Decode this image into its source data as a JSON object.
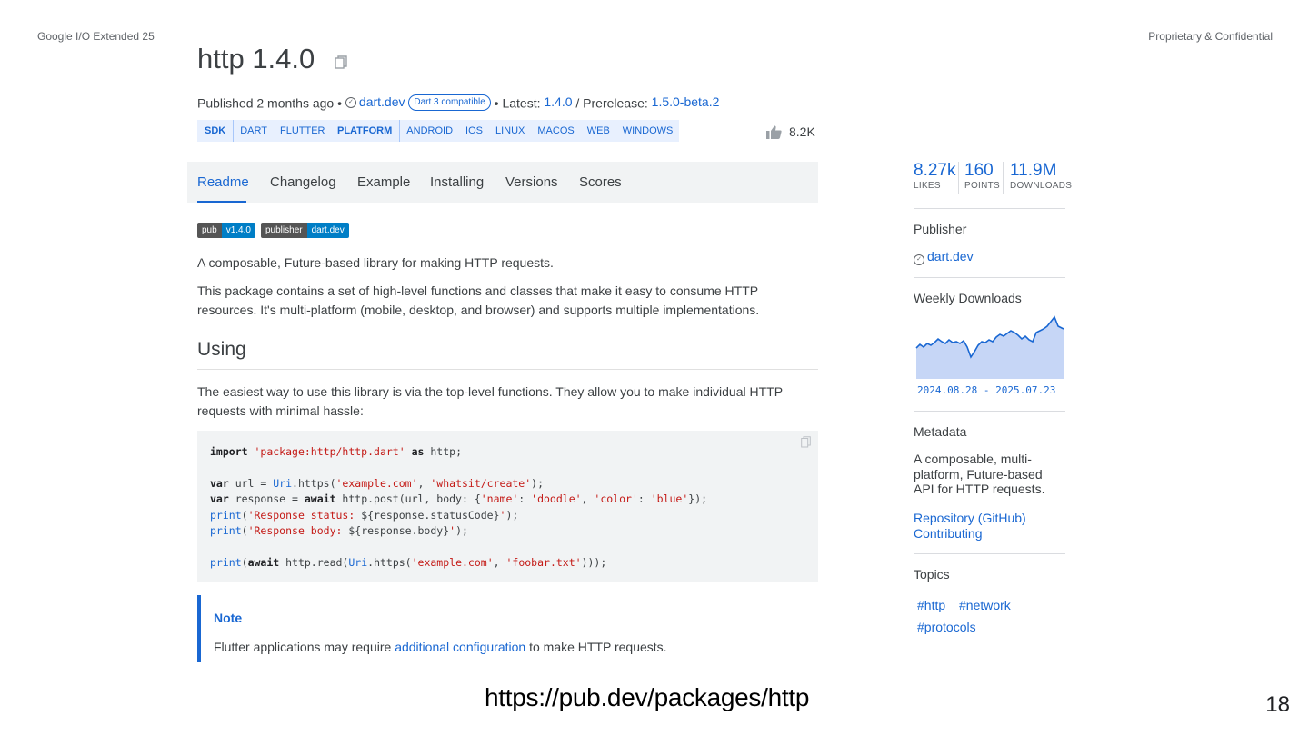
{
  "slide": {
    "header_left": "Google I/O Extended 25",
    "header_right": "Proprietary & Confidential",
    "page_number": "18",
    "url_caption": "https://pub.dev/packages/http"
  },
  "package": {
    "title": "http 1.4.0",
    "published_prefix": "Published 2 months ago •",
    "publisher": "dart.dev",
    "dart3_badge": "Dart 3 compatible",
    "latest_label": "• Latest:",
    "latest_version": "1.4.0",
    "prerelease_label": "/ Prerelease:",
    "prerelease_version": "1.5.0-beta.2",
    "likes_inline": "8.2K"
  },
  "tags": {
    "sdk": {
      "title": "SDK",
      "items": [
        "DART",
        "FLUTTER"
      ]
    },
    "platform": {
      "title": "PLATFORM",
      "items": [
        "ANDROID",
        "IOS",
        "LINUX",
        "MACOS",
        "WEB",
        "WINDOWS"
      ]
    }
  },
  "tabs": [
    "Readme",
    "Changelog",
    "Example",
    "Installing",
    "Versions",
    "Scores"
  ],
  "readme": {
    "badge_pub": {
      "left": "pub",
      "right": "v1.4.0"
    },
    "badge_publisher": {
      "left": "publisher",
      "right": "dart.dev"
    },
    "intro": "A composable, Future-based library for making HTTP requests.",
    "desc_line1": "This package contains a set of high-level functions and classes that make it easy to consume HTTP",
    "desc_line2": "resources. It's multi-platform (mobile, desktop, and browser) and supports multiple implementations.",
    "using_heading": "Using",
    "using_line1": "The easiest way to use this library is via the top-level functions. They allow you to make individual HTTP",
    "using_line2": "requests with minimal hassle:",
    "note_title": "Note",
    "note_prefix": "Flutter applications may require",
    "note_link": "additional configuration",
    "note_suffix": "to make HTTP requests."
  },
  "sidebar": {
    "likes_value": "8.27k",
    "likes_label": "LIKES",
    "points_value": "160",
    "points_label": "POINTS",
    "downloads_value": "11.9M",
    "downloads_label": "DOWNLOADS",
    "publisher_heading": "Publisher",
    "publisher_name": "dart.dev",
    "weekly_heading": "Weekly Downloads",
    "weekly_range": "2024.08.28 - 2025.07.23",
    "metadata_heading": "Metadata",
    "metadata_line1": "A composable, multi-",
    "metadata_line2": "platform, Future-based",
    "metadata_line3": "API for HTTP requests.",
    "repo_link": "Repository (GitHub)",
    "contrib_link": "Contributing",
    "topics_heading": "Topics",
    "topics": [
      "#http",
      "#network",
      "#protocols"
    ]
  },
  "colors": {
    "accent": "#1967d2",
    "tag_bg": "#e8f0fe",
    "code_bg": "#f1f3f4",
    "badge_blue": "#007ec6",
    "badge_gray": "#555555"
  }
}
